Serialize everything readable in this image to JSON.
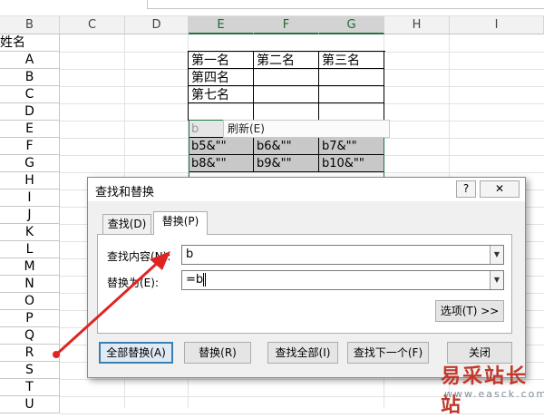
{
  "sheet": {
    "columns": [
      "B",
      "C",
      "D",
      "E",
      "F",
      "G",
      "H",
      "I"
    ],
    "b_header": "姓名",
    "b_rows": [
      "A",
      "B",
      "C",
      "D",
      "E",
      "F",
      "G",
      "H",
      "I",
      "J",
      "K",
      "L",
      "M",
      "N",
      "O",
      "P",
      "Q",
      "R",
      "S",
      "T",
      "U"
    ],
    "table_rows": [
      [
        "第一名",
        "第二名",
        "第三名"
      ],
      [
        "第四名",
        "",
        ""
      ],
      [
        "第七名",
        "",
        ""
      ],
      [
        "",
        "",
        ""
      ]
    ],
    "formula_rows": [
      [
        "b5&\"\"",
        "b6&\"\"",
        "b7&\"\""
      ],
      [
        "b8&\"\"",
        "b9&\"\"",
        "b10&\"\""
      ]
    ],
    "formula_row0_partial": [
      "b",
      "&\"\"",
      "b4&\"\""
    ],
    "refresh_label": "刷新(E)"
  },
  "dialog": {
    "title": "查找和替换",
    "help_btn": "?",
    "close_btn": "✕",
    "tabs": [
      {
        "label": "查找(D)",
        "active": false
      },
      {
        "label": "替换(P)",
        "active": true
      }
    ],
    "find_label": "查找内容(N):",
    "find_value": "b",
    "replace_label": "替换为(E):",
    "replace_value": "=b",
    "options_btn": "选项(T) >>",
    "buttons": {
      "replace_all": "全部替换(A)",
      "replace": "替换(R)",
      "find_all": "查找全部(I)",
      "find_next": "查找下一个(F)",
      "close": "关闭"
    }
  },
  "watermark": {
    "name": "易采站长站",
    "url": "www.easck.com"
  },
  "colors": {
    "accent_green": "#217346",
    "arrow_red": "#e02424",
    "dialog_bg": "#f0f0f0"
  }
}
